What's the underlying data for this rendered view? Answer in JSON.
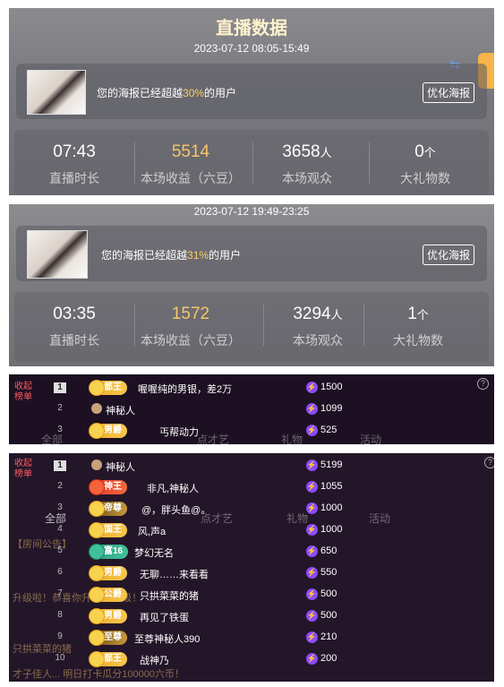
{
  "panel1": {
    "title": "直播数据",
    "date": "2023-07-12 08:05-15:49",
    "poster_prefix": "您的海报已经超越",
    "poster_percent": "30%",
    "poster_suffix": "的用户",
    "optimize_btn": "优化海报",
    "stats": [
      {
        "value": "07:43",
        "unit": "",
        "label": "直播时长"
      },
      {
        "value": "5514",
        "unit": "",
        "label": "本场收益（六豆）"
      },
      {
        "value": "3658",
        "unit": "人",
        "label": "本场观众"
      },
      {
        "value": "0",
        "unit": "个",
        "label": "大礼物数"
      }
    ],
    "side_tab": "PK"
  },
  "panel2": {
    "date": "2023-07-12 19:49-23:25",
    "poster_prefix": "您的海报已经超越",
    "poster_percent": "31%",
    "poster_suffix": "的用户",
    "optimize_btn": "优化海报",
    "stats": [
      {
        "value": "03:35",
        "unit": "",
        "label": "直播时长"
      },
      {
        "value": "1572",
        "unit": "",
        "label": "本场收益（六豆）"
      },
      {
        "value": "3294",
        "unit": "人",
        "label": "本场观众"
      },
      {
        "value": "1",
        "unit": "个",
        "label": "大礼物数"
      }
    ]
  },
  "rank_label": "收起\n榜单",
  "panel3": {
    "ghost_tabs": [
      "全部",
      "点才艺",
      "礼物",
      "活动"
    ],
    "rows": [
      {
        "rank": "1",
        "badge": "都王",
        "name": "喔喔纯的男银，差2万",
        "score": "1500"
      },
      {
        "rank": "2",
        "badge": "",
        "name": "神秘人",
        "score": "1099"
      },
      {
        "rank": "3",
        "badge": "男爵",
        "name": "丐帮动力",
        "score": "525"
      }
    ]
  },
  "panel4": {
    "ghost_lines": [
      "【房间公告】",
      "升级啦！恭喜你升级至24级！",
      "只拱菜菜的猪",
      "才子佳人... 明日打卡瓜分100000六币！"
    ],
    "rows": [
      {
        "rank": "1",
        "badge": "",
        "name": "神秘人",
        "score": "5199"
      },
      {
        "rank": "2",
        "badge": "神王",
        "name": "非凡,神秘人",
        "score": "1055"
      },
      {
        "rank": "3",
        "badge": "帝尊",
        "name": "@，胖头鱼@。",
        "score": "1000"
      },
      {
        "rank": "4",
        "badge": "国王",
        "name": "风,声a",
        "score": "1000"
      },
      {
        "rank": "5",
        "badge": "富16",
        "name": "梦幻无名",
        "score": "650"
      },
      {
        "rank": "6",
        "badge": "男爵",
        "name": "无聊……来看看",
        "score": "550"
      },
      {
        "rank": "7",
        "badge": "公爵",
        "name": "只拱菜菜的猪",
        "score": "500"
      },
      {
        "rank": "8",
        "badge": "男爵",
        "name": "再见了铁蛋",
        "score": "500"
      },
      {
        "rank": "9",
        "badge": "至尊",
        "name": "至尊神秘人390",
        "score": "210"
      },
      {
        "rank": "10",
        "badge": "都王",
        "name": "战神乃",
        "score": "200"
      }
    ]
  }
}
